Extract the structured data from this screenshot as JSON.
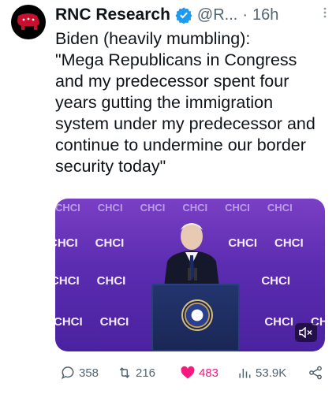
{
  "tweet": {
    "author_name": "RNC Research",
    "handle": "@R...",
    "separator": "·",
    "time": "16h",
    "text": "Biden (heavily mumbling):\n\"Mega Republicans in Congress and my predecessor spent four years gutting the immigration system under my predecessor and continue to undermine our border security today\""
  },
  "media": {
    "banner_text": "CHCI"
  },
  "actions": {
    "replies": "358",
    "reposts": "216",
    "likes": "483",
    "views": "53.9K"
  },
  "colors": {
    "text": "#0f1419",
    "secondary": "#536471",
    "like": "#f91880",
    "verified": "#1d9bf0",
    "brand": "#c8102e"
  },
  "icons": {
    "avatar": "elephant-logo-icon",
    "verified": "verified-badge-icon",
    "more": "more-options-icon",
    "reply": "reply-icon",
    "repost": "repost-icon",
    "like": "heart-icon",
    "views": "views-icon",
    "share": "share-icon",
    "mute": "mute-icon"
  }
}
